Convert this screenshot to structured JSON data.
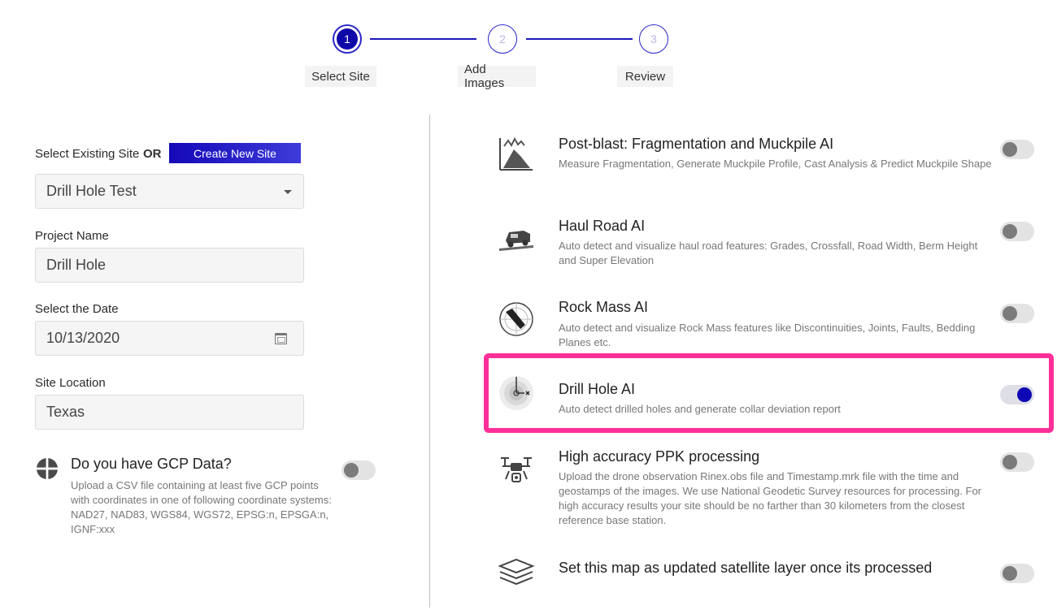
{
  "stepper": {
    "steps": [
      {
        "number": "1",
        "label": "Select Site"
      },
      {
        "number": "2",
        "label": "Add Images"
      },
      {
        "number": "3",
        "label": "Review"
      }
    ],
    "active_step": 1
  },
  "form": {
    "existing_site_label": "Select Existing Site",
    "or_label": "OR",
    "create_button": "Create New Site",
    "site_select_value": "Drill Hole Test",
    "project_name_label": "Project Name",
    "project_name_value": "Drill Hole",
    "date_label": "Select the Date",
    "date_value": "10/13/2020",
    "location_label": "Site Location",
    "location_value": "Texas",
    "gcp": {
      "title": "Do you have GCP Data?",
      "description": "Upload a CSV file containing at least five GCP points with coordinates in one of following coordinate systems: NAD27, NAD83, WGS84, WGS72, EPSG:n, EPSGA:n, IGNF:xxx",
      "enabled": false
    }
  },
  "features": [
    {
      "icon": "mountain-chart-icon",
      "title": "Post-blast: Fragmentation and Muckpile AI",
      "description": "Measure Fragmentation, Generate Muckpile Profile, Cast Analysis & Predict Muckpile Shape",
      "enabled": false
    },
    {
      "icon": "haul-truck-icon",
      "title": "Haul Road AI",
      "description": "Auto detect and visualize haul road features: Grades, Crossfall, Road Width, Berm Height and Super Elevation",
      "enabled": false
    },
    {
      "icon": "stereonet-icon",
      "title": "Rock Mass AI",
      "description": "Auto detect and visualize Rock Mass features like Discontinuities, Joints, Faults, Bedding Planes etc.",
      "enabled": false
    },
    {
      "icon": "drill-hole-icon",
      "title": "Drill Hole AI",
      "description": "Auto detect drilled holes and generate collar deviation report",
      "enabled": true
    },
    {
      "icon": "drone-icon",
      "title": "High accuracy PPK processing",
      "description": "Upload the drone observation Rinex.obs file and Timestamp.mrk file with the time and geostamps of the images. We use National Geodetic Survey resources for processing. For high accuracy results your site should be no farther than 30 kilometers from the closest reference base station.",
      "enabled": false
    },
    {
      "icon": "layers-icon",
      "title": "Set this map as updated satellite layer once its processed",
      "description": "",
      "enabled": false
    }
  ],
  "colors": {
    "accent": "#0f08a8",
    "highlight": "#ff2f9a",
    "toggle_off": "#7b7b7b"
  }
}
